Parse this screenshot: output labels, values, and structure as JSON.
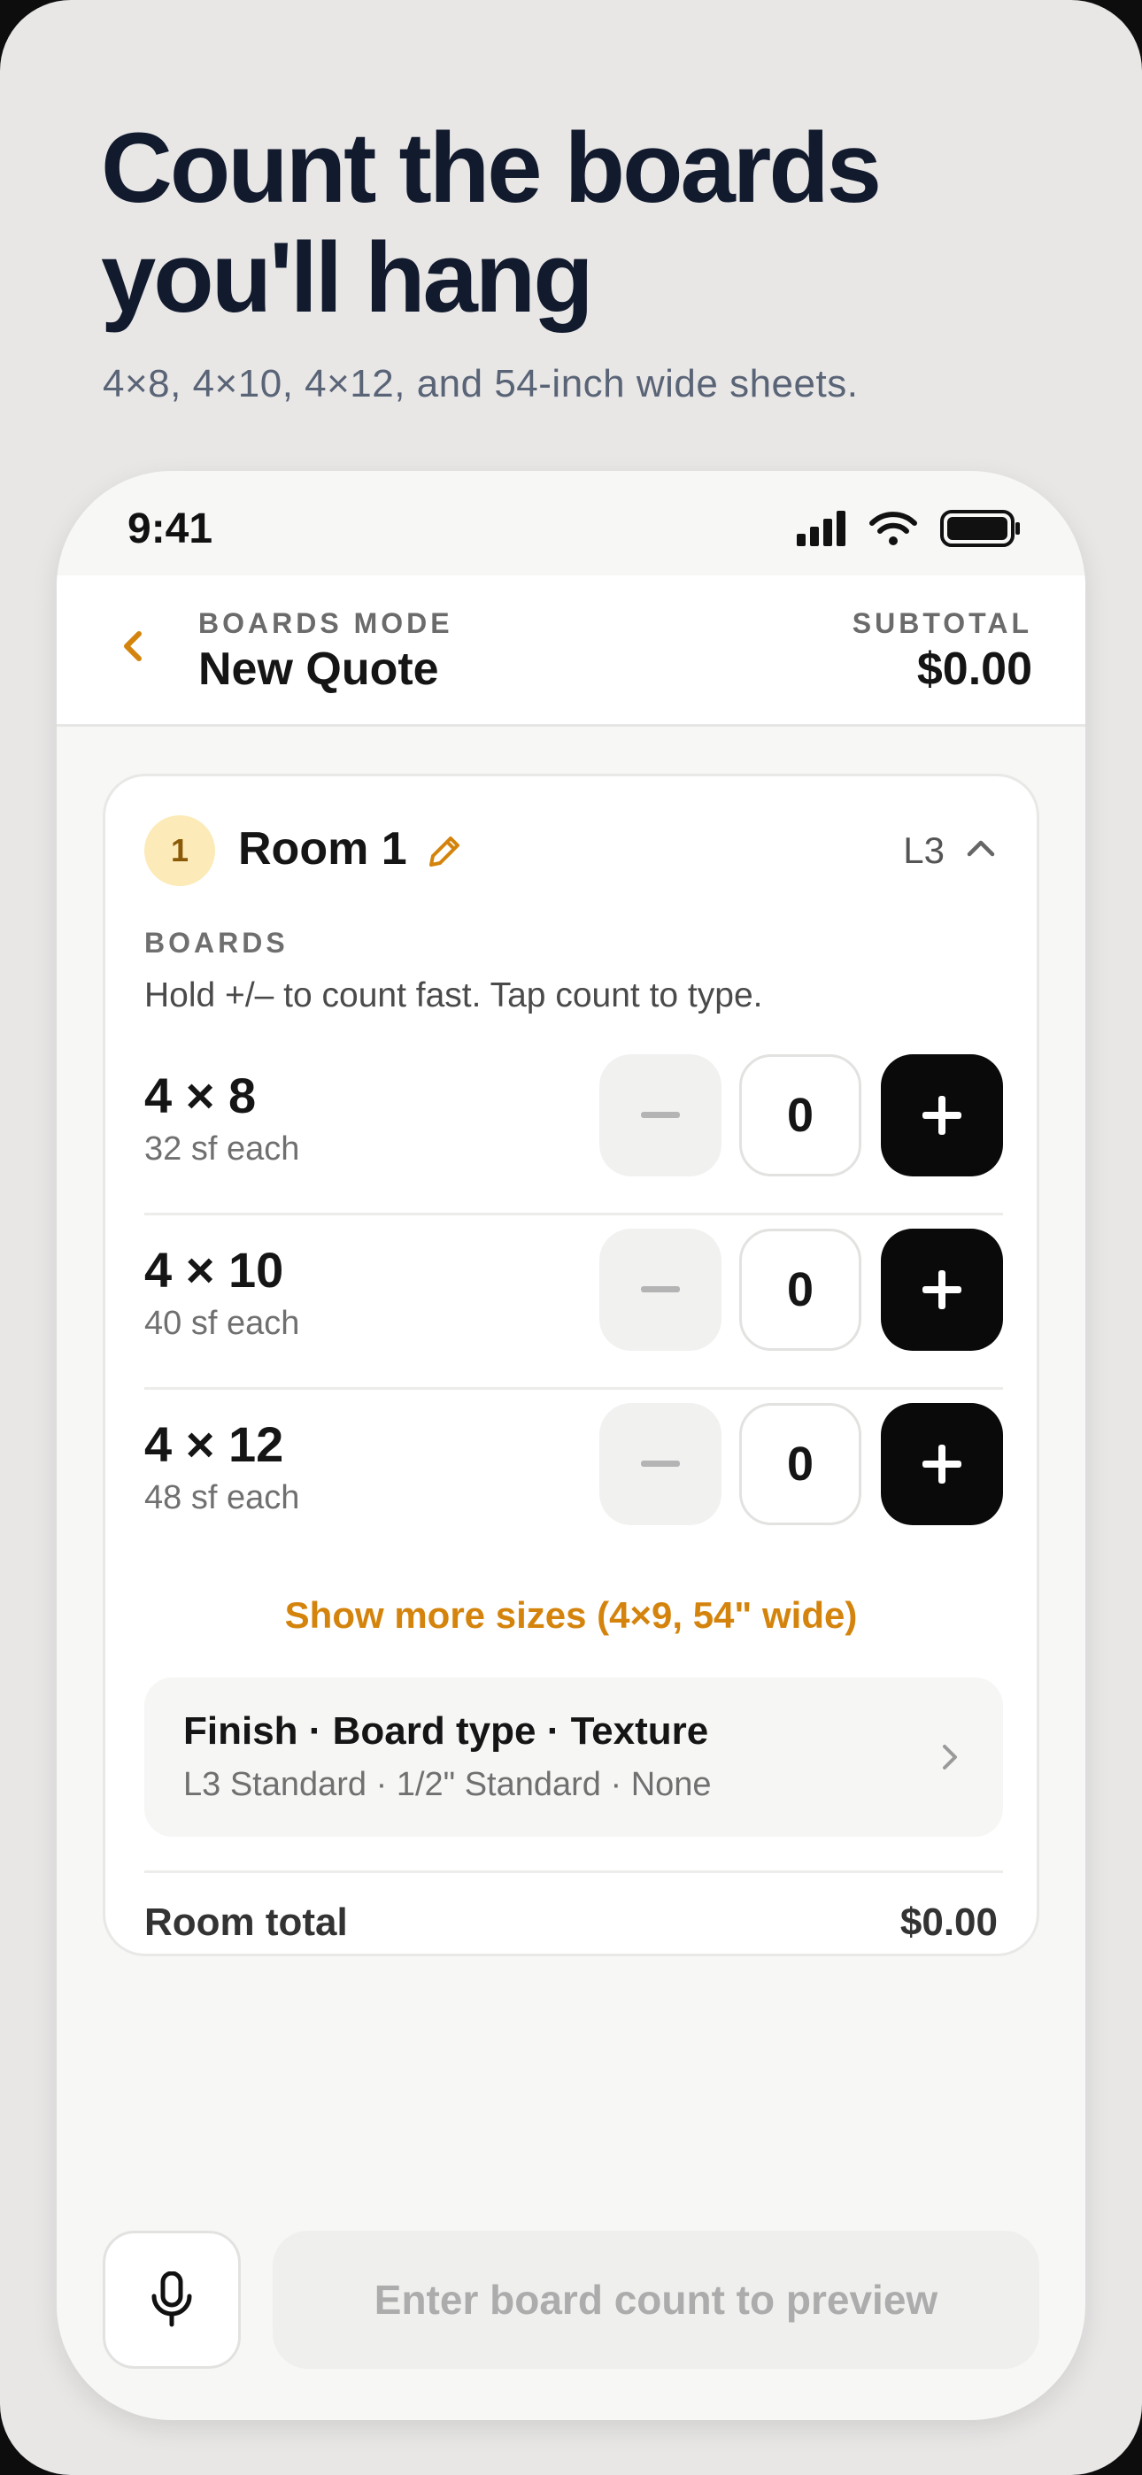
{
  "hero": {
    "title_line1": "Count the boards",
    "title_line2": "you'll hang",
    "subtitle": "4×8, 4×10, 4×12, and 54-inch wide sheets."
  },
  "status_bar": {
    "time": "9:41",
    "icons": [
      "signal-icon",
      "wifi-icon",
      "battery-icon"
    ]
  },
  "header": {
    "mode_label": "BOARDS MODE",
    "title": "New Quote",
    "subtotal_label": "SUBTOTAL",
    "subtotal_value": "$0.00"
  },
  "room": {
    "number": "1",
    "name": "Room 1",
    "level": "L3",
    "boards_label": "BOARDS",
    "hint": "Hold +/– to count fast. Tap count to type.",
    "boards": [
      {
        "size": "4 × 8",
        "area": "32 sf each",
        "count": "0"
      },
      {
        "size": "4 × 10",
        "area": "40 sf each",
        "count": "0"
      },
      {
        "size": "4 × 12",
        "area": "48 sf each",
        "count": "0"
      }
    ],
    "more_sizes": "Show more sizes (4×9, 54\" wide)",
    "finish": {
      "title": "Finish · Board type · Texture",
      "detail": "L3 Standard · 1/2\" Standard · None"
    },
    "total_label": "Room total",
    "total_value": "$0.00"
  },
  "footer": {
    "preview_label": "Enter board count to preview"
  },
  "colors": {
    "accent": "#d4840d",
    "badge_bg": "#fcebb8",
    "dark": "#0a0a0a"
  }
}
